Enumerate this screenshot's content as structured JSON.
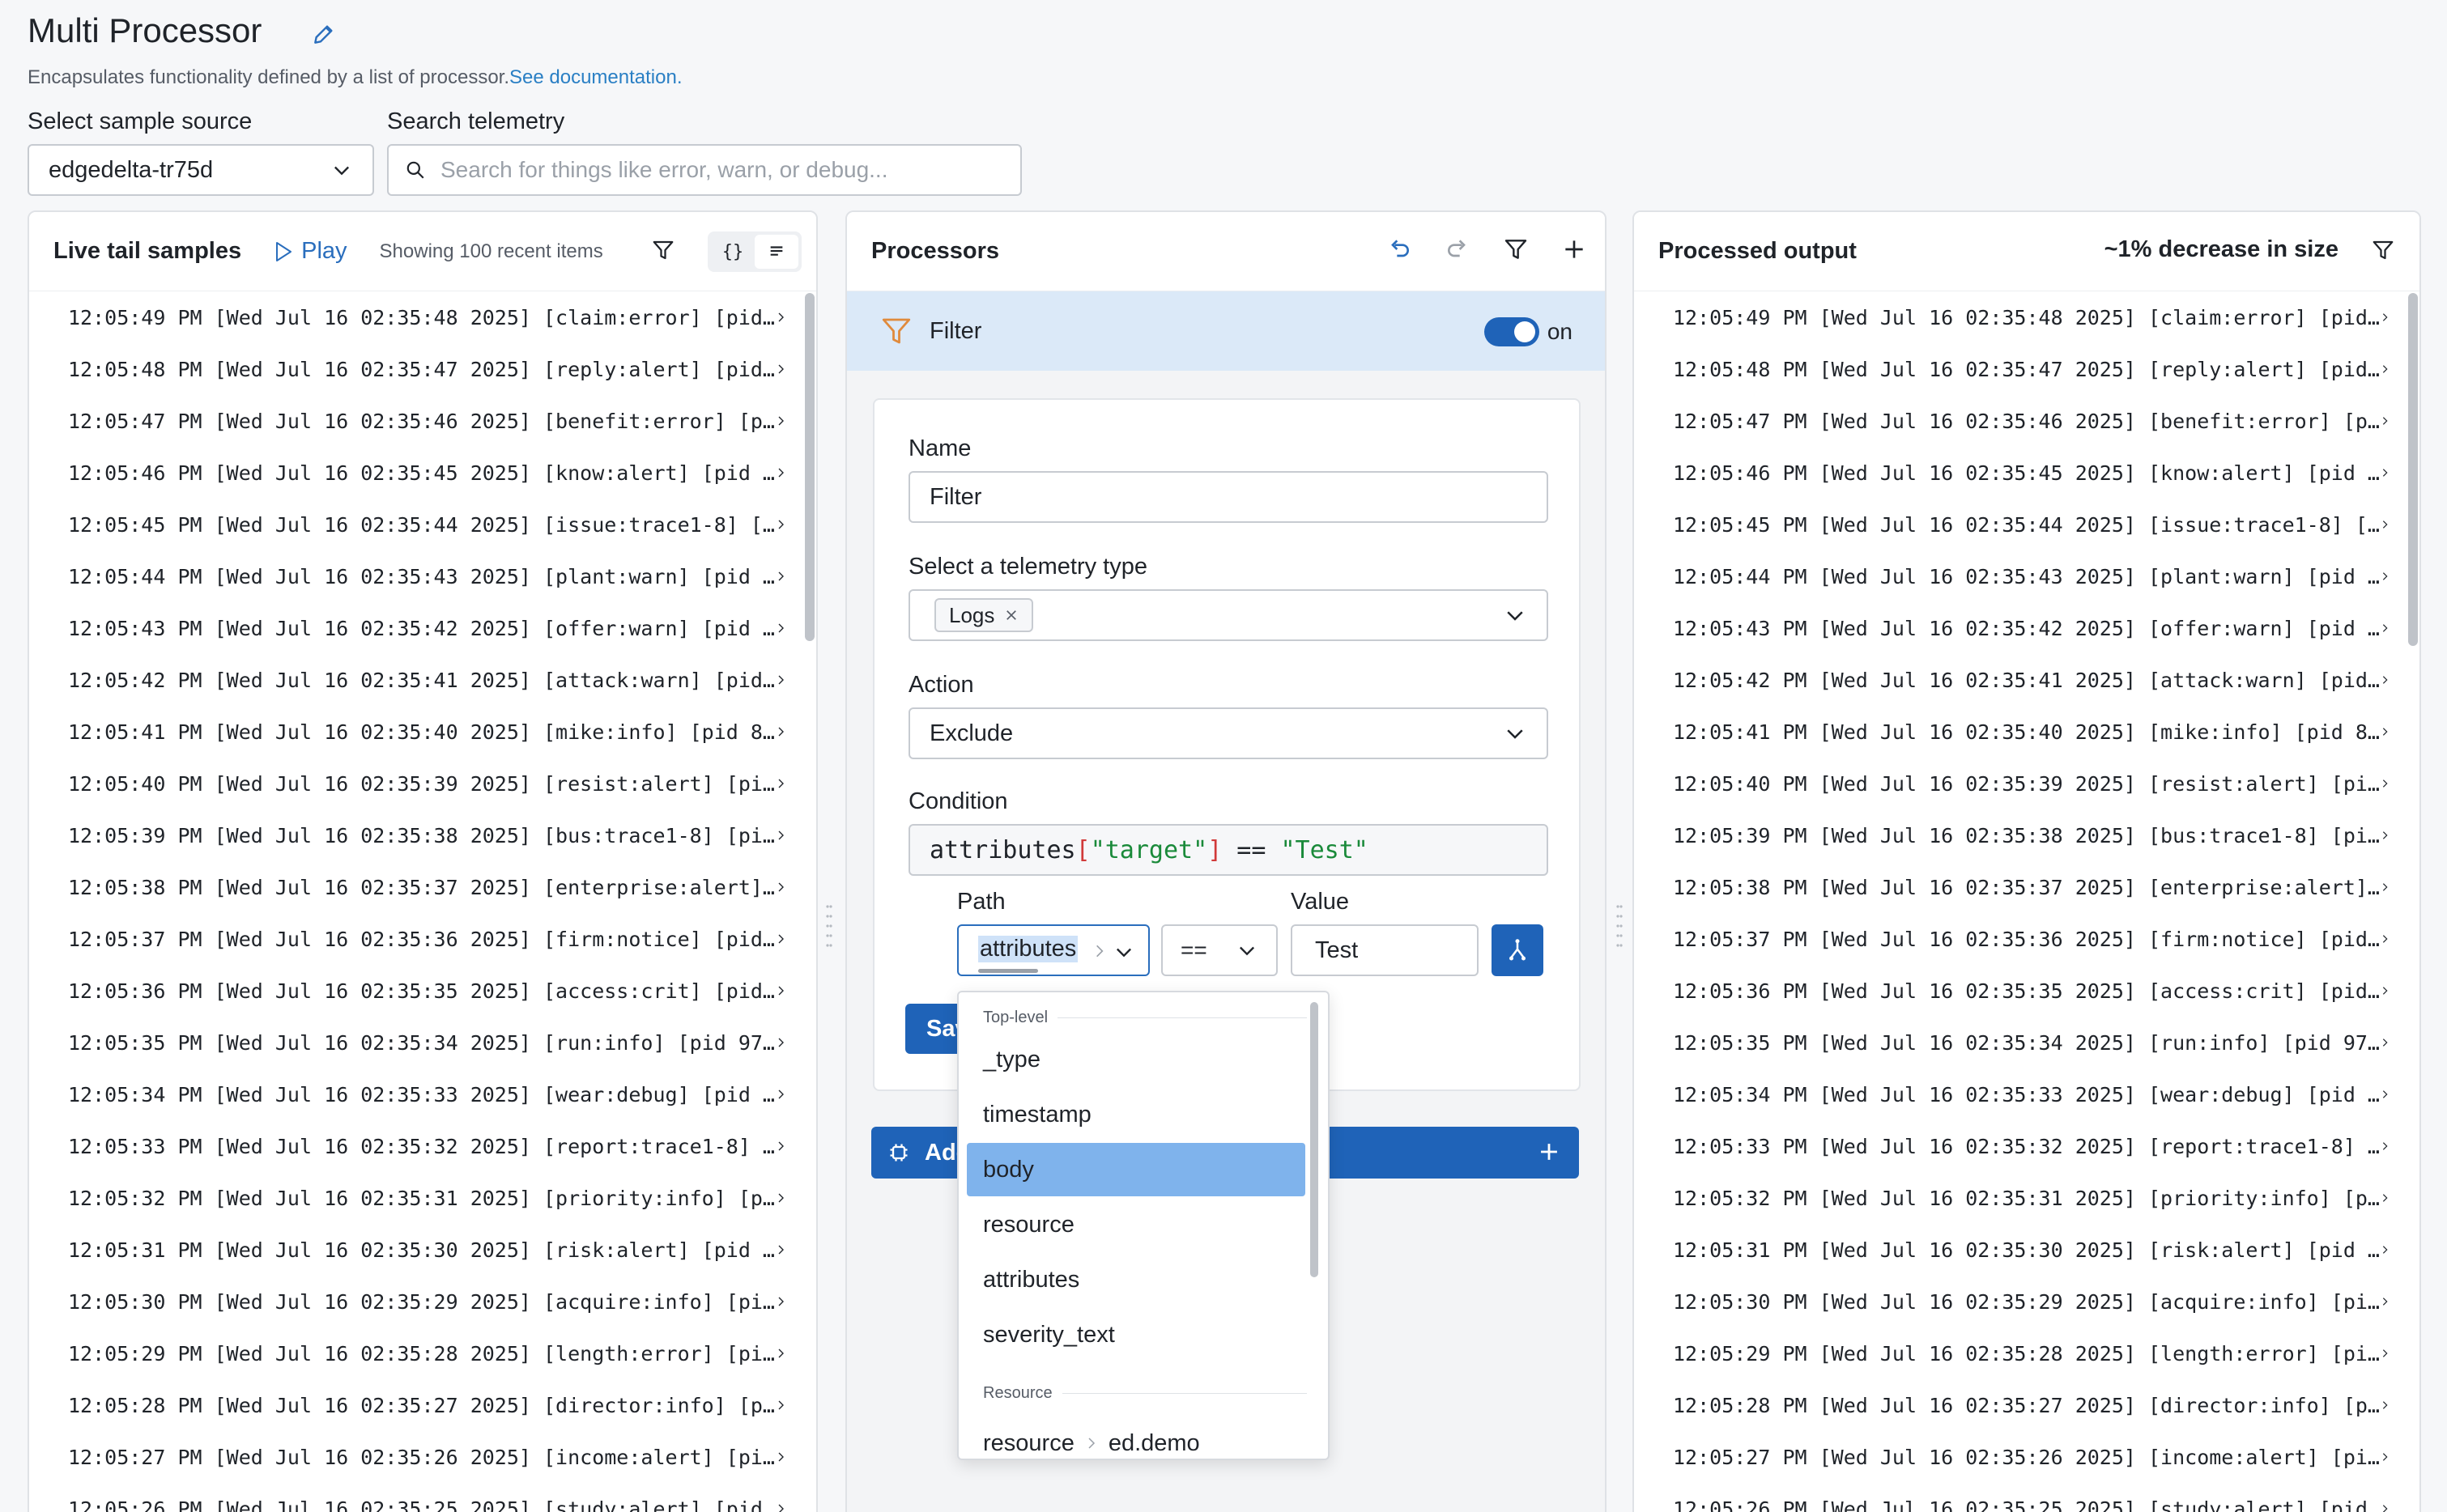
{
  "header": {
    "title": "Multi Processor",
    "subtitle": "Encapsulates functionality defined by a list of processor.",
    "doc_link": "See documentation."
  },
  "source": {
    "label": "Select sample source",
    "value": "edgedelta-tr75d"
  },
  "search": {
    "label": "Search telemetry",
    "placeholder": "Search for things like error, warn, or debug..."
  },
  "live": {
    "title": "Live tail samples",
    "play": "Play",
    "showing": "Showing 100 recent items",
    "view_json": "{}",
    "rows": [
      "12:05:49 PM [Wed Jul 16 02:35:48 2025] [claim:error] [pid…",
      "12:05:48 PM [Wed Jul 16 02:35:47 2025] [reply:alert] [pid…",
      "12:05:47 PM [Wed Jul 16 02:35:46 2025] [benefit:error] [p…",
      "12:05:46 PM [Wed Jul 16 02:35:45 2025] [know:alert] [pid …",
      "12:05:45 PM [Wed Jul 16 02:35:44 2025] [issue:trace1-8] […",
      "12:05:44 PM [Wed Jul 16 02:35:43 2025] [plant:warn] [pid …",
      "12:05:43 PM [Wed Jul 16 02:35:42 2025] [offer:warn] [pid …",
      "12:05:42 PM [Wed Jul 16 02:35:41 2025] [attack:warn] [pid…",
      "12:05:41 PM [Wed Jul 16 02:35:40 2025] [mike:info] [pid 8…",
      "12:05:40 PM [Wed Jul 16 02:35:39 2025] [resist:alert] [pi…",
      "12:05:39 PM [Wed Jul 16 02:35:38 2025] [bus:trace1-8] [pi…",
      "12:05:38 PM [Wed Jul 16 02:35:37 2025] [enterprise:alert]…",
      "12:05:37 PM [Wed Jul 16 02:35:36 2025] [firm:notice] [pid…",
      "12:05:36 PM [Wed Jul 16 02:35:35 2025] [access:crit] [pid…",
      "12:05:35 PM [Wed Jul 16 02:35:34 2025] [run:info] [pid 97…",
      "12:05:34 PM [Wed Jul 16 02:35:33 2025] [wear:debug] [pid …",
      "12:05:33 PM [Wed Jul 16 02:35:32 2025] [report:trace1-8] …",
      "12:05:32 PM [Wed Jul 16 02:35:31 2025] [priority:info] [p…",
      "12:05:31 PM [Wed Jul 16 02:35:30 2025] [risk:alert] [pid …",
      "12:05:30 PM [Wed Jul 16 02:35:29 2025] [acquire:info] [pi…",
      "12:05:29 PM [Wed Jul 16 02:35:28 2025] [length:error] [pi…",
      "12:05:28 PM [Wed Jul 16 02:35:27 2025] [director:info] [p…",
      "12:05:27 PM [Wed Jul 16 02:35:26 2025] [income:alert] [pi…",
      "12:05:26 PM [Wed Jul 16 02:35:25 2025] [study:alert] [pid…"
    ]
  },
  "processors": {
    "title": "Processors",
    "filter_label": "Filter",
    "toggle_label": "on",
    "form": {
      "name_label": "Name",
      "name_value": "Filter",
      "telemetry_label": "Select a telemetry type",
      "telemetry_chip": "Logs",
      "action_label": "Action",
      "action_value": "Exclude",
      "condition_label": "Condition",
      "condition": {
        "t1": "attributes",
        "t2": "[",
        "t3": "\"target\"",
        "t4": "]",
        "t5": " == ",
        "t6": "\"Test\""
      },
      "path_label": "Path",
      "path_value": "attributes",
      "operator": "==",
      "value_label": "Value",
      "value": "Test",
      "save_label": "Save",
      "add_label": "Add processor"
    },
    "dropdown": {
      "group_top": "Top-level",
      "items": [
        "_type",
        "timestamp",
        "body",
        "resource",
        "attributes",
        "severity_text"
      ],
      "selected": "body",
      "group_resource": "Resource",
      "resource_item_a": "resource",
      "resource_item_b": "ed.demo"
    }
  },
  "output": {
    "title": "Processed output",
    "decrease": "~1% decrease in size",
    "rows": [
      "12:05:49 PM [Wed Jul 16 02:35:48 2025] [claim:error] [pid…",
      "12:05:48 PM [Wed Jul 16 02:35:47 2025] [reply:alert] [pid…",
      "12:05:47 PM [Wed Jul 16 02:35:46 2025] [benefit:error] [p…",
      "12:05:46 PM [Wed Jul 16 02:35:45 2025] [know:alert] [pid …",
      "12:05:45 PM [Wed Jul 16 02:35:44 2025] [issue:trace1-8] […",
      "12:05:44 PM [Wed Jul 16 02:35:43 2025] [plant:warn] [pid …",
      "12:05:43 PM [Wed Jul 16 02:35:42 2025] [offer:warn] [pid …",
      "12:05:42 PM [Wed Jul 16 02:35:41 2025] [attack:warn] [pid…",
      "12:05:41 PM [Wed Jul 16 02:35:40 2025] [mike:info] [pid 8…",
      "12:05:40 PM [Wed Jul 16 02:35:39 2025] [resist:alert] [pi…",
      "12:05:39 PM [Wed Jul 16 02:35:38 2025] [bus:trace1-8] [pi…",
      "12:05:38 PM [Wed Jul 16 02:35:37 2025] [enterprise:alert]…",
      "12:05:37 PM [Wed Jul 16 02:35:36 2025] [firm:notice] [pid…",
      "12:05:36 PM [Wed Jul 16 02:35:35 2025] [access:crit] [pid…",
      "12:05:35 PM [Wed Jul 16 02:35:34 2025] [run:info] [pid 97…",
      "12:05:34 PM [Wed Jul 16 02:35:33 2025] [wear:debug] [pid …",
      "12:05:33 PM [Wed Jul 16 02:35:32 2025] [report:trace1-8] …",
      "12:05:32 PM [Wed Jul 16 02:35:31 2025] [priority:info] [p…",
      "12:05:31 PM [Wed Jul 16 02:35:30 2025] [risk:alert] [pid …",
      "12:05:30 PM [Wed Jul 16 02:35:29 2025] [acquire:info] [pi…",
      "12:05:29 PM [Wed Jul 16 02:35:28 2025] [length:error] [pi…",
      "12:05:28 PM [Wed Jul 16 02:35:27 2025] [director:info] [p…",
      "12:05:27 PM [Wed Jul 16 02:35:26 2025] [income:alert] [pi…",
      "12:05:26 PM [Wed Jul 16 02:35:25 2025] [study:alert] [pid…"
    ]
  },
  "colors": {
    "accent": "#1f63b8",
    "link": "#2a7fc4",
    "selected_bg": "#7fb3ec",
    "filter_row_bg": "#dbe9f8"
  }
}
